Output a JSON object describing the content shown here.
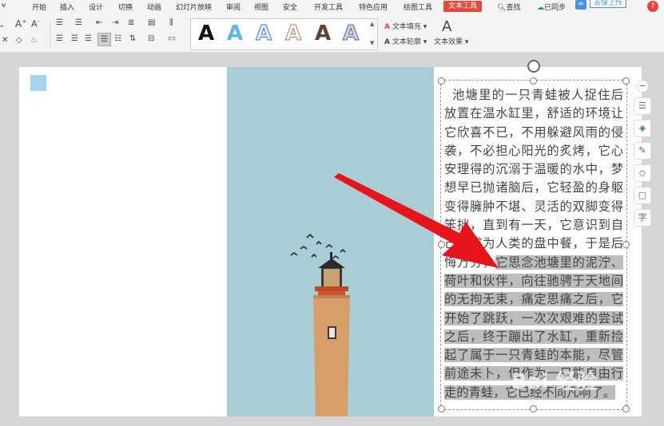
{
  "menubar": {
    "items": [
      "开始",
      "插入",
      "设计",
      "切换",
      "动画",
      "幻灯片放映",
      "审阅",
      "视图",
      "安全",
      "开发工具",
      "特色应用",
      "绘图工具",
      "文本工具"
    ],
    "search": "查找",
    "sync": "已同步",
    "upload": "去保上传",
    "help": "?"
  },
  "ribbon": {
    "text_fill": "文本填充",
    "text_outline": "文本轮廓",
    "text_effect": "文本效果",
    "style_letter": "A",
    "font_size_up": "A",
    "font_size_down": "A"
  },
  "colors": {
    "accent": "#e5473b",
    "photo_sky": "#a9cdd4",
    "arrow": "#e8141b"
  },
  "textbox": {
    "before_highlight": "池塘里的一只青蛙被人捉住后放置在温水缸里，舒适的环境让它欣喜不已，不用躲避风雨的侵袭，不必担心阳光的炙烤，它心安理得的沉溺于温暖的水中，梦想早已抛诸脑后，它轻盈的身躯变得臃肿不堪、灵活的双脚变得笨拙，直到有一天，它意识到自己将成为人类的盘中餐，于是后悔万分，",
    "highlighted": "它思念池塘里的泥泞、荷叶和伙伴，向往驰骋于天地间的无拘无束，痛定思痛之后，它开始了跳跃，一次次艰难的尝试之后，终于蹦出了水缸，重新捡起了属于一只青蛙的本能，尽管前途未卜，但作为一只能自由行走的青蛙，它已经不同凡响了。"
  },
  "watermark": "Bai 经验",
  "side_tools": [
    "zoom-out-icon",
    "text-wrap-icon",
    "layers-icon",
    "pen-icon",
    "fill-icon",
    "frame-icon",
    "font-icon"
  ],
  "side_labels": {
    "font": "字"
  }
}
